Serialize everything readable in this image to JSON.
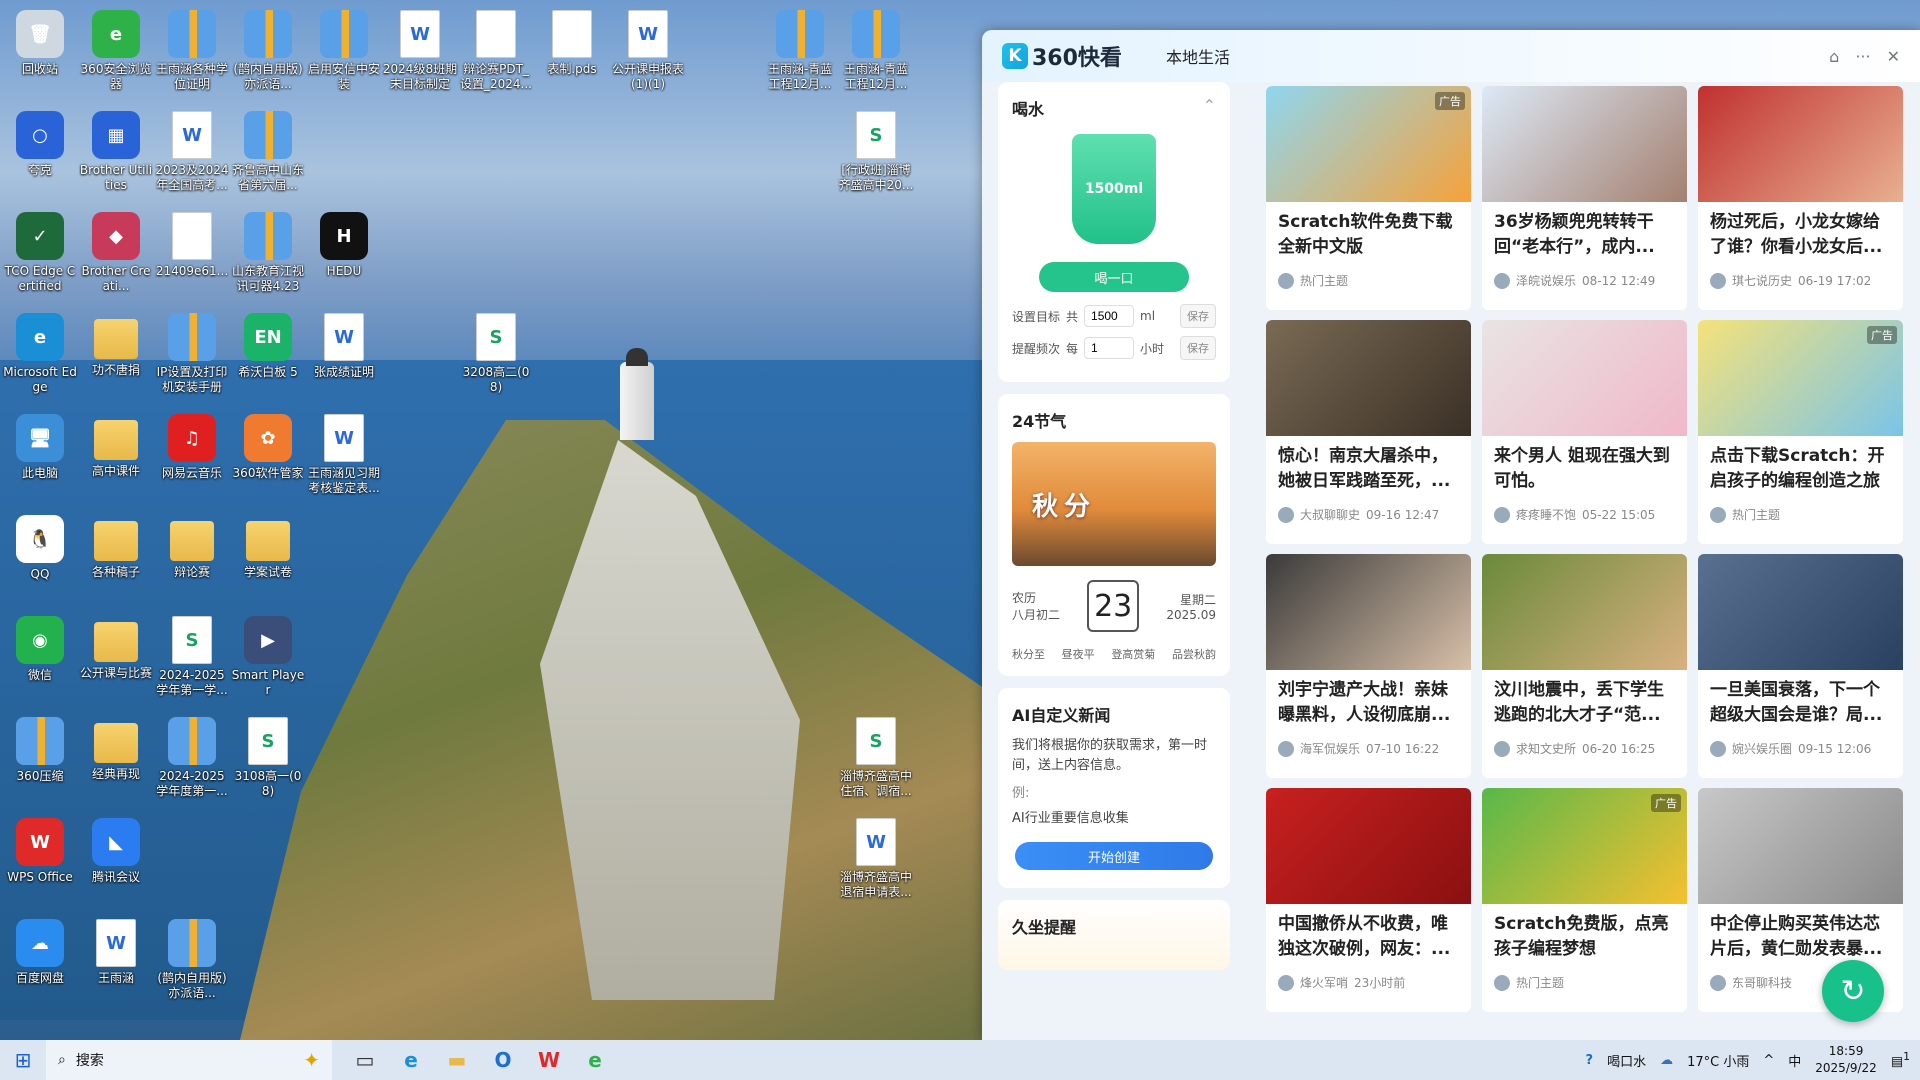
{
  "desktop_icons": [
    {
      "label": "回收站",
      "kind": "app",
      "color": "#cfd8e0",
      "glyph": "🗑"
    },
    {
      "label": "360安全浏览器",
      "kind": "app",
      "color": "#2fb14a",
      "glyph": "e"
    },
    {
      "label": "王雨涵各种学位证明",
      "kind": "zip",
      "glyph": ""
    },
    {
      "label": "(鹊内自用版)亦派语...",
      "kind": "zip",
      "glyph": ""
    },
    {
      "label": "启用安信中安装",
      "kind": "zip",
      "glyph": ""
    },
    {
      "label": "2024级8班期末目标制定",
      "kind": "doc",
      "glyph": "W"
    },
    {
      "label": "辩论赛PDT_设置_2024...",
      "kind": "blank",
      "glyph": ""
    },
    {
      "label": "表制.pds",
      "kind": "blank",
      "glyph": ""
    },
    {
      "label": "公开课申报表(1)(1)",
      "kind": "doc",
      "glyph": "W"
    },
    {
      "label": "王雨涵-青蓝工程12月...",
      "kind": "zip",
      "glyph": ""
    },
    {
      "label": "王雨涵-青蓝工程12月...",
      "kind": "zip",
      "glyph": ""
    },
    {
      "label": "夸克",
      "kind": "app",
      "color": "#2a62d8",
      "glyph": "○"
    },
    {
      "label": "Brother Utilities",
      "kind": "app",
      "color": "#2a62d8",
      "glyph": "▦"
    },
    {
      "label": "2023及2024年全国高考...",
      "kind": "doc",
      "glyph": "W"
    },
    {
      "label": "齐鲁高中山东省第六届...",
      "kind": "zip",
      "glyph": ""
    },
    {
      "label": "[行政班]淄博齐盛高中20...",
      "kind": "sheet",
      "glyph": "S"
    },
    {
      "label": "TCO Edge Certified",
      "kind": "app",
      "color": "#1e6a3a",
      "glyph": "✓"
    },
    {
      "label": "Brother Creati...",
      "kind": "app",
      "color": "#c83a5a",
      "glyph": "◆"
    },
    {
      "label": "21409e61...",
      "kind": "blank",
      "glyph": ""
    },
    {
      "label": "山东教育江视讯可器4.23",
      "kind": "zip",
      "glyph": ""
    },
    {
      "label": "HEDU",
      "kind": "app",
      "color": "#111111",
      "glyph": "H"
    },
    {
      "label": "Microsoft Edge",
      "kind": "app",
      "color": "#1a8fd6",
      "glyph": "e"
    },
    {
      "label": "功不唐捐",
      "kind": "folder",
      "glyph": ""
    },
    {
      "label": "IP设置及打印机安装手册",
      "kind": "zip",
      "glyph": ""
    },
    {
      "label": "希沃白板 5",
      "kind": "app",
      "color": "#1bb36a",
      "glyph": "EN"
    },
    {
      "label": "张成绩证明",
      "kind": "doc",
      "glyph": "W"
    },
    {
      "label": "3208高二(08)",
      "kind": "sheet",
      "glyph": "S"
    },
    {
      "label": "此电脑",
      "kind": "app",
      "color": "#3a8fd8",
      "glyph": "🖥"
    },
    {
      "label": "高中课件",
      "kind": "folder",
      "glyph": ""
    },
    {
      "label": "网易云音乐",
      "kind": "app",
      "color": "#e02020",
      "glyph": "♫"
    },
    {
      "label": "360软件管家",
      "kind": "app",
      "color": "#f07a30",
      "glyph": "✿"
    },
    {
      "label": "王雨涵见习期考核鉴定表...",
      "kind": "doc",
      "glyph": "W"
    },
    {
      "label": "QQ",
      "kind": "app",
      "color": "#ffffff",
      "glyph": "🐧"
    },
    {
      "label": "各种稿子",
      "kind": "folder",
      "glyph": ""
    },
    {
      "label": "辩论赛",
      "kind": "folder",
      "glyph": ""
    },
    {
      "label": "学案试卷",
      "kind": "folder",
      "glyph": ""
    },
    {
      "label": "微信",
      "kind": "app",
      "color": "#22b14c",
      "glyph": "◉"
    },
    {
      "label": "公开课与比赛",
      "kind": "folder",
      "glyph": ""
    },
    {
      "label": "2024-2025学年第一学...",
      "kind": "sheet",
      "glyph": "S"
    },
    {
      "label": "Smart Player",
      "kind": "app",
      "color": "#3b4e7a",
      "glyph": "▶"
    },
    {
      "label": "360压缩",
      "kind": "zip",
      "glyph": ""
    },
    {
      "label": "经典再现",
      "kind": "folder",
      "glyph": ""
    },
    {
      "label": "2024-2025学年度第一...",
      "kind": "zip",
      "glyph": ""
    },
    {
      "label": "3108高一(08)",
      "kind": "sheet",
      "glyph": "S"
    },
    {
      "label": "淄博齐盛高中住宿、调宿...",
      "kind": "sheet",
      "glyph": "S"
    },
    {
      "label": "WPS Office",
      "kind": "app",
      "color": "#e02a2a",
      "glyph": "W"
    },
    {
      "label": "腾讯会议",
      "kind": "app",
      "color": "#2b7cf0",
      "glyph": "◣"
    },
    {
      "label": "淄博齐盛高中退宿申请表...",
      "kind": "doc",
      "glyph": "W"
    },
    {
      "label": "百度网盘",
      "kind": "app",
      "color": "#2b8cf0",
      "glyph": "☁"
    },
    {
      "label": "王雨涵",
      "kind": "doc",
      "glyph": "W"
    },
    {
      "label": "(鹊内自用版)亦派语...",
      "kind": "zip",
      "glyph": ""
    }
  ],
  "panel": {
    "logo": "360快看",
    "logo_k": "K",
    "tab": "本地生活",
    "ctrl_icons": {
      "gift": "⌂",
      "more": "···",
      "close": "✕"
    },
    "water": {
      "title": "喝水",
      "collapse": "⌃",
      "cup_amount": "1500ml",
      "drink_button": "喝一口",
      "goal_label": "设置目标",
      "goal_prefix": "共",
      "goal_value": "1500",
      "goal_unit": "ml",
      "save": "保存",
      "freq_label": "提醒频次",
      "freq_prefix": "每",
      "freq_value": "1",
      "freq_unit": "小时"
    },
    "solar": {
      "title": "24节气",
      "season": "秋分",
      "lunar_label": "农历",
      "lunar_date": "八月初二",
      "day": "23",
      "weekday": "星期二",
      "yearmonth": "2025.09",
      "terms": [
        "秋分至",
        "昼夜平",
        "登高赏菊",
        "品尝秋韵"
      ]
    },
    "ai": {
      "title": "AI自定义新闻",
      "desc": "我们将根据你的获取需求，第一时间，送上内容信息。",
      "example_label": "例:",
      "example": "AI行业重要信息收集",
      "button": "开始创建"
    },
    "sedentary": {
      "title": "久坐提醒"
    },
    "refresh": "↻",
    "news": [
      {
        "title": "Scratch软件免费下载全新中文版",
        "source": "热门主题",
        "time": "",
        "ad": "广告",
        "bg": "linear-gradient(135deg,#8fd6f0,#f6a23a)"
      },
      {
        "title": "36岁杨颖兜兜转转干回“老本行”，成内...",
        "source": "泽皖说娱乐",
        "time": "08-12 12:49",
        "ad": "",
        "bg": "linear-gradient(135deg,#dce9f6,#a48070)"
      },
      {
        "title": "杨过死后，小龙女嫁给了谁？你看小龙女后...",
        "source": "琪七说历史",
        "time": "06-19 17:02",
        "ad": "",
        "bg": "linear-gradient(135deg,#c03030,#e8b090)"
      },
      {
        "title": "惊心！南京大屠杀中，她被日军践踏至死，...",
        "source": "大叔聊聊史",
        "time": "09-16 12:47",
        "ad": "",
        "bg": "linear-gradient(135deg,#7a6a55,#3a3025)"
      },
      {
        "title": "来个男人 姐现在强大到可怕。",
        "source": "疼疼睡不饱",
        "time": "05-22 15:05",
        "ad": "",
        "bg": "linear-gradient(135deg,#e8e4e4,#f0b8c8)"
      },
      {
        "title": "点击下载Scratch：开启孩子的编程创造之旅",
        "source": "热门主题",
        "time": "",
        "ad": "广告",
        "bg": "linear-gradient(135deg,#f5e27a,#7ac4e8)"
      },
      {
        "title": "刘宇宁遗产大战！亲妹曝黑料，人设彻底崩...",
        "source": "海军侃娱乐",
        "time": "07-10 16:22",
        "ad": "",
        "bg": "linear-gradient(135deg,#3a3a3a,#d8c0a8)"
      },
      {
        "title": "汶川地震中，丢下学生逃跑的北大才子“范...",
        "source": "求知文史所",
        "time": "06-20 16:25",
        "ad": "",
        "bg": "linear-gradient(135deg,#6a8a3a,#d8b080)"
      },
      {
        "title": "一旦美国衰落，下一个超级大国会是谁？局...",
        "source": "婉兴娱乐圈",
        "time": "09-15 12:06",
        "ad": "",
        "bg": "linear-gradient(135deg,#5a7090,#2a4060)"
      },
      {
        "title": "中国撤侨从不收费，唯独这次破例，网友：...",
        "source": "烽火军哨",
        "time": "23小时前",
        "ad": "",
        "bg": "linear-gradient(135deg,#c82020,#8a1010)"
      },
      {
        "title": "Scratch免费版，点亮孩子编程梦想",
        "source": "热门主题",
        "time": "",
        "ad": "广告",
        "bg": "linear-gradient(135deg,#58b84a,#f6c030)"
      },
      {
        "title": "中企停止购买英伟达芯片后，黄仁勋发表暴...",
        "source": "东哥聊科技",
        "time": "",
        "ad": "",
        "bg": "linear-gradient(135deg,#c8c8c8,#8a8a8a)"
      }
    ]
  },
  "taskbar": {
    "start_icon": "⊞",
    "search_icon": "⌕",
    "search_placeholder": "搜索",
    "search_sparkle": "✦",
    "apps": [
      {
        "name": "task-view",
        "glyph": "▭",
        "color": "#333333"
      },
      {
        "name": "edge",
        "glyph": "e",
        "color": "#1a8fd6"
      },
      {
        "name": "file-explorer",
        "glyph": "▬",
        "color": "#e8b84a"
      },
      {
        "name": "outlook",
        "glyph": "O",
        "color": "#1a6fd0"
      },
      {
        "name": "wps",
        "glyph": "W",
        "color": "#e02a2a"
      },
      {
        "name": "360-browser",
        "glyph": "e",
        "color": "#2fb14a"
      }
    ],
    "tray_help": "?",
    "drink_label": "喝口水",
    "weather_icon": "☁",
    "weather": "17°C 小雨",
    "chevron": "^",
    "ime": "中",
    "time": "18:59",
    "date": "2025/9/22",
    "notify_icon": "▤",
    "notify_count": "1"
  }
}
